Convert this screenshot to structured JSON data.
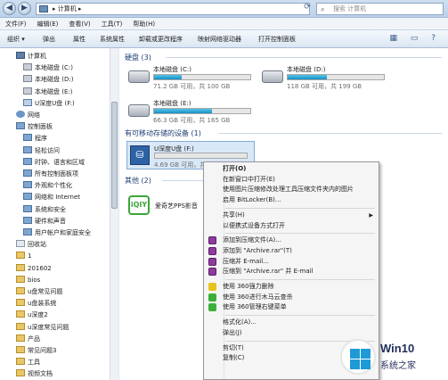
{
  "address": {
    "path": "▸ 计算机 ▸",
    "search_placeholder": "搜索 计算机"
  },
  "menubar": [
    "文件(F)",
    "编辑(E)",
    "查看(V)",
    "工具(T)",
    "帮助(H)"
  ],
  "toolbar": [
    "组织 ▾",
    "弹出",
    "属性",
    "系统属性",
    "卸载或更改程序",
    "映射网络驱动器",
    "打开控制面板"
  ],
  "nav": [
    {
      "label": "计算机",
      "icon": "computer-icon"
    },
    {
      "label": "本地磁盘 (C:)",
      "icon": "drive-icon"
    },
    {
      "label": "本地磁盘 (D:)",
      "icon": "drive-icon"
    },
    {
      "label": "本地磁盘 (E:)",
      "icon": "drive-icon"
    },
    {
      "label": "U深度U盘 (F:)",
      "icon": "usb-drive-icon"
    },
    {
      "label": "网络",
      "icon": "network-icon"
    },
    {
      "label": "控制面板",
      "icon": "control-panel-icon"
    },
    {
      "label": "程序",
      "icon": "control-panel-icon"
    },
    {
      "label": "轻松访问",
      "icon": "control-panel-icon"
    },
    {
      "label": "时钟、语言和区域",
      "icon": "control-panel-icon"
    },
    {
      "label": "所有控制面板项",
      "icon": "control-panel-icon"
    },
    {
      "label": "外观和个性化",
      "icon": "control-panel-icon"
    },
    {
      "label": "网络和 Internet",
      "icon": "control-panel-icon"
    },
    {
      "label": "系统和安全",
      "icon": "control-panel-icon"
    },
    {
      "label": "硬件和声音",
      "icon": "control-panel-icon"
    },
    {
      "label": "用户帐户和家庭安全",
      "icon": "control-panel-icon"
    },
    {
      "label": "回收站",
      "icon": "recycle-bin-icon"
    },
    {
      "label": "1",
      "icon": "folder-icon"
    },
    {
      "label": "201602",
      "icon": "folder-icon"
    },
    {
      "label": "bios",
      "icon": "folder-icon"
    },
    {
      "label": "u盘常见问题",
      "icon": "folder-icon"
    },
    {
      "label": "u盘装系统",
      "icon": "folder-icon"
    },
    {
      "label": "u深度2",
      "icon": "folder-icon"
    },
    {
      "label": "u深度常见问题",
      "icon": "folder-icon"
    },
    {
      "label": "产品",
      "icon": "folder-icon"
    },
    {
      "label": "常见问题3",
      "icon": "folder-icon"
    },
    {
      "label": "工具",
      "icon": "folder-icon"
    },
    {
      "label": "视频文档",
      "icon": "folder-icon"
    }
  ],
  "groups": {
    "hdd": "硬盘 (3)",
    "removable": "有可移动存储的设备 (1)",
    "other": "其他 (2)"
  },
  "drives": [
    {
      "name": "本地磁盘 (C:)",
      "detail": "71.2 GB 可用，共 100 GB",
      "used": 0.29
    },
    {
      "name": "本地磁盘 (D:)",
      "detail": "118 GB 可用，共 199 GB",
      "used": 0.41
    },
    {
      "name": "本地磁盘 (E:)",
      "detail": "66.3 GB 可用，共 165 GB",
      "used": 0.6
    }
  ],
  "usb": {
    "name": "U深度U盘 (F:)",
    "detail": "4.69 GB 可用，共 7.45 GB",
    "used": 0.37
  },
  "other_item": "爱奇艺PPS影音",
  "context_menu": [
    {
      "label": "打开(O)",
      "bold": true
    },
    {
      "label": "在新窗口中打开(E)"
    },
    {
      "label": "使用图片压缩修改处理工具压缩文件夹内的图片"
    },
    {
      "label": "启用 BitLocker(B)..."
    },
    {
      "sep": true
    },
    {
      "label": "共享(H)",
      "sub": true
    },
    {
      "label": "以便携式设备方式打开"
    },
    {
      "sep": true
    },
    {
      "label": "添加到压缩文件(A)...",
      "icon": "winrar-icon"
    },
    {
      "label": "添加到 \"Archive.rar\"(T)",
      "icon": "winrar-icon"
    },
    {
      "label": "压缩并 E-mail...",
      "icon": "winrar-icon"
    },
    {
      "label": "压缩到 \"Archive.rar\" 并 E-mail",
      "icon": "winrar-icon"
    },
    {
      "sep": true
    },
    {
      "label": "使用 360强力删除",
      "icon": "shred-icon"
    },
    {
      "label": "使用 360进行木马云查杀",
      "icon": "360-icon"
    },
    {
      "label": "使用 360管理右键菜单",
      "icon": "360-icon"
    },
    {
      "sep": true
    },
    {
      "label": "格式化(A)..."
    },
    {
      "label": "弹出(J)"
    },
    {
      "sep": true
    },
    {
      "label": "剪切(T)"
    },
    {
      "label": "复制(C)"
    }
  ],
  "watermark": {
    "title": "Win10",
    "subtitle": "系统之家"
  }
}
